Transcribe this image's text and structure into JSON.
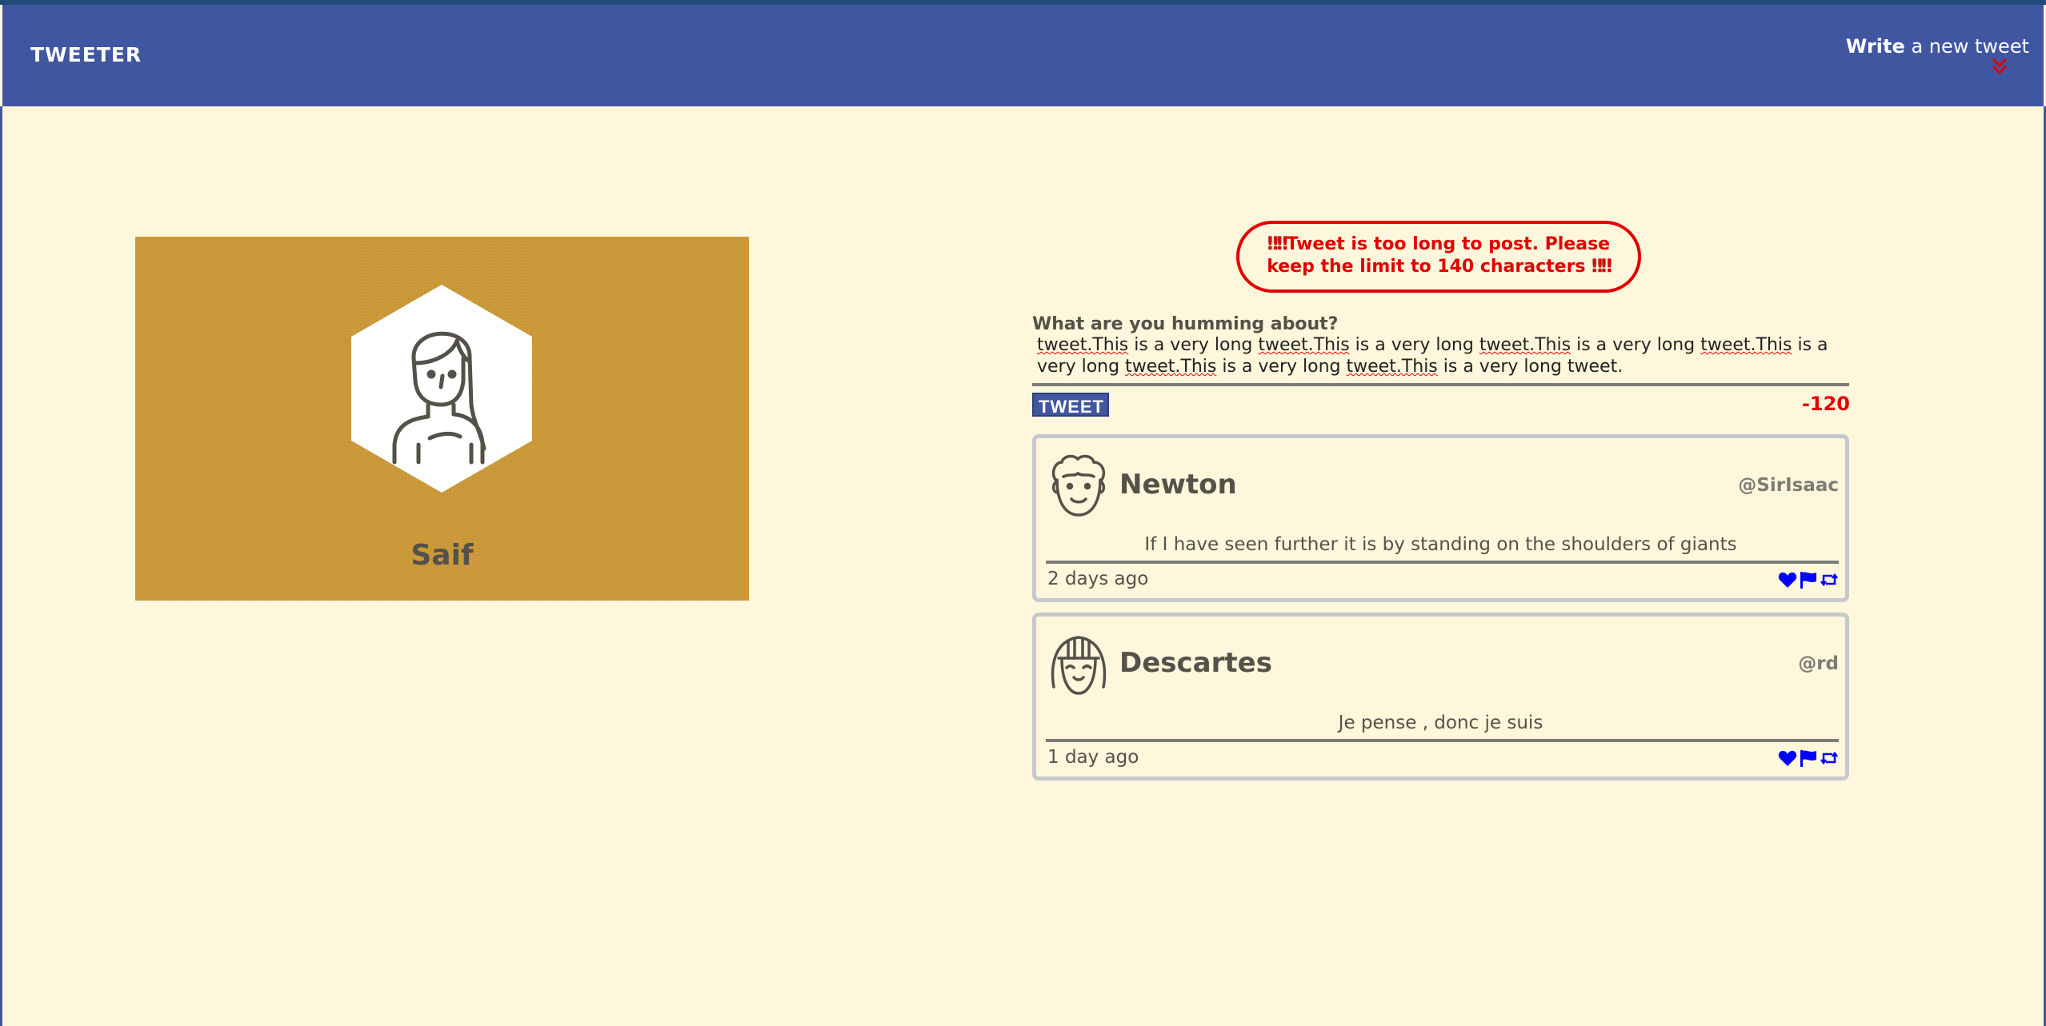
{
  "nav": {
    "brand": "TWEETER",
    "write_bold": "Write",
    "write_rest": "a new tweet"
  },
  "profile": {
    "name": "Saif",
    "background_color": "#cc9a3a"
  },
  "compose": {
    "error_marks": "‼‼",
    "error_text": "Tweet is too long to post. Please keep the limit to 140 characters",
    "label": "What are you humming about?",
    "text_parts": [
      "tweet.This",
      "is a very long",
      "tweet.This",
      "is a very long",
      "tweet.This",
      "is a very long",
      "tweet.This",
      "is a very long",
      "tweet.This",
      "is a very long",
      "tweet.This",
      "is a very long tweet."
    ],
    "button_label": "TWEET",
    "counter": "-120"
  },
  "tweets": [
    {
      "name": "Newton",
      "handle": "@SirIsaac",
      "content": "If I have seen further it is by standing on the shoulders of giants",
      "time": "2 days ago",
      "avatar_icon": "curly-hair-man-avatar-icon"
    },
    {
      "name": "Descartes",
      "handle": "@rd",
      "content": "Je pense , donc je suis",
      "time": "1 day ago",
      "avatar_icon": "bob-hair-avatar-icon"
    }
  ],
  "colors": {
    "nav": "#4056a1",
    "page_bg": "#fef7dc",
    "error": "#e10000",
    "action_icons": "#0000ff"
  }
}
